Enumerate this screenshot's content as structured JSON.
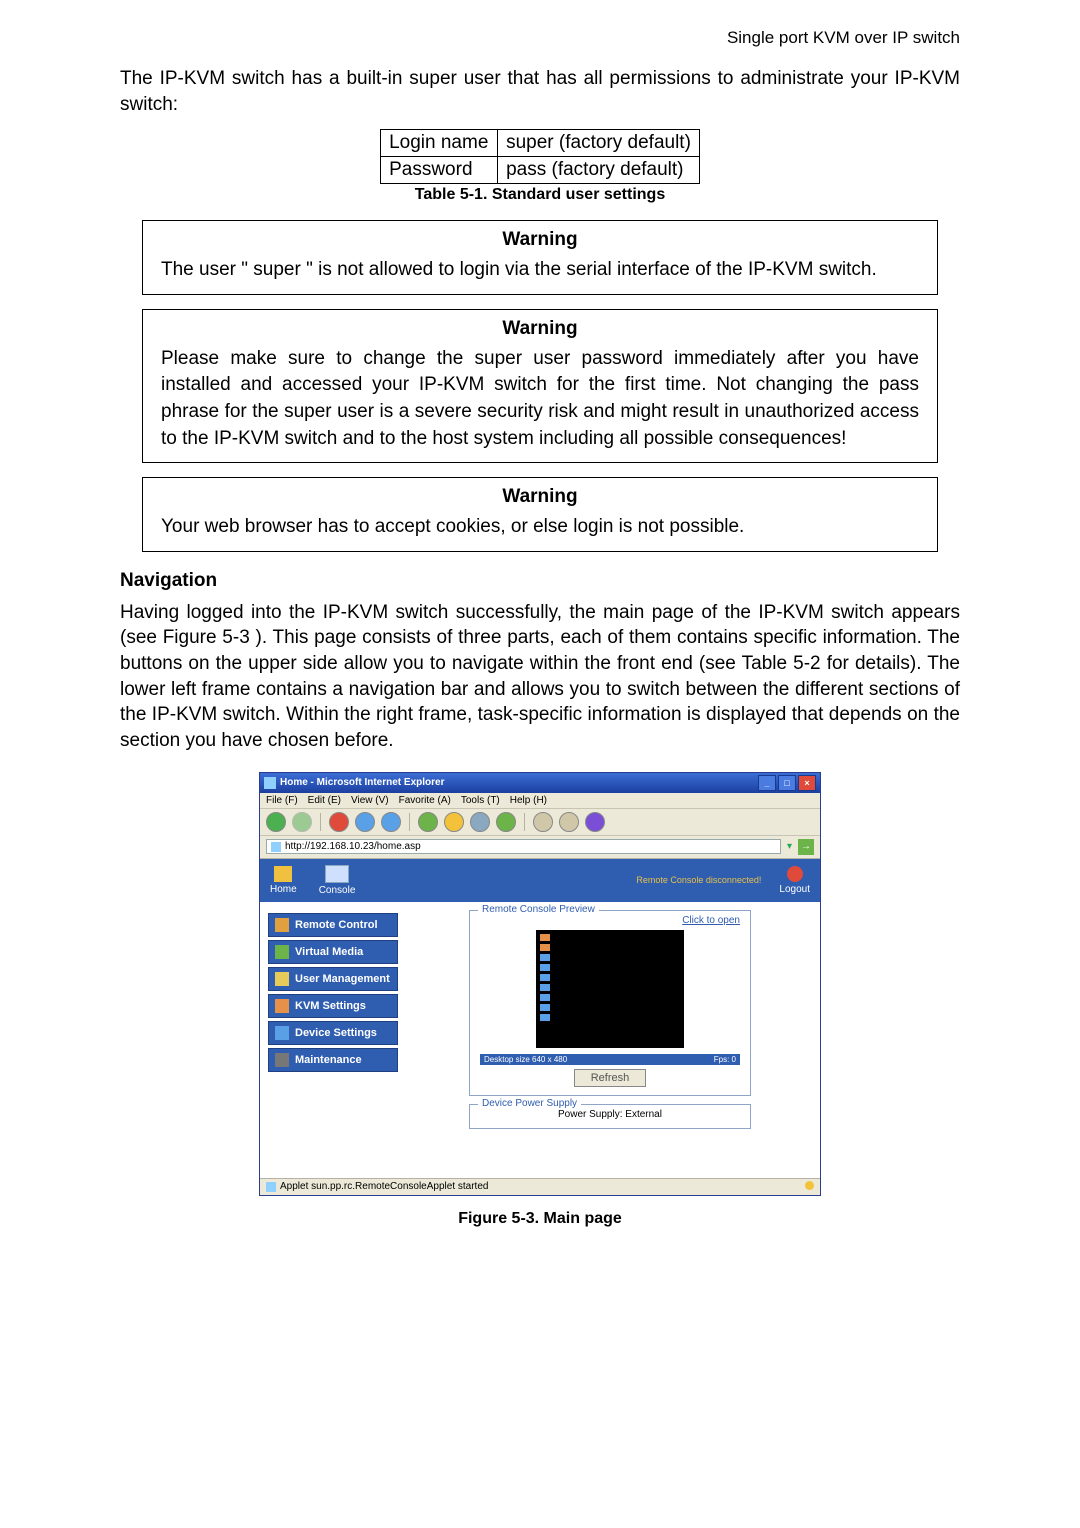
{
  "header": {
    "product": "Single port KVM over IP switch"
  },
  "intro": "The IP-KVM switch has a built-in super user that has all permissions to administrate your IP-KVM switch:",
  "cred_table": {
    "rows": [
      {
        "k": "Login name",
        "v": "super (factory default)"
      },
      {
        "k": "Password",
        "v": "pass (factory default)"
      }
    ],
    "caption": "Table 5-1. Standard user settings"
  },
  "warn1": {
    "title": "Warning",
    "body": "The user \" super \" is not allowed to login via the serial interface of the IP-KVM switch."
  },
  "warn2": {
    "title": "Warning",
    "body": "Please make sure to change the super user password immediately after you have installed and accessed your IP-KVM switch for the first time. Not changing the pass phrase for the super user is a severe security risk and might result in unauthorized access to the IP-KVM switch and to the host system including all possible consequences!"
  },
  "warn3": {
    "title": "Warning",
    "body": "Your web browser has to accept cookies, or else login is not possible."
  },
  "nav_heading": "Navigation",
  "nav_body": "Having logged into the IP-KVM switch successfully, the main page of the IP-KVM switch appears (see Figure 5-3 ). This page consists of three parts, each of them contains specific information. The buttons on the upper side allow you to navigate within the front end (see Table 5-2 for details). The lower left frame contains a navigation bar and allows you to switch between the different sections of the IP-KVM switch. Within the right frame, task-specific information is displayed that depends on the section you have chosen before.",
  "figure_caption": "Figure 5-3. Main page",
  "screenshot": {
    "window_title": "Home - Microsoft Internet Explorer",
    "menu": {
      "file": "File (F)",
      "edit": "Edit (E)",
      "view": "View (V)",
      "fav": "Favorite (A)",
      "tools": "Tools (T)",
      "help": "Help (H)"
    },
    "address_url": "http://192.168.10.23/home.asp",
    "go": "→",
    "topbar": {
      "home": "Home",
      "console": "Console",
      "status": "Remote Console disconnected!",
      "logout": "Logout"
    },
    "sidebar": [
      "Remote Control",
      "Virtual Media",
      "User Management",
      "KVM Settings",
      "Device Settings",
      "Maintenance"
    ],
    "preview": {
      "panel_title": "Remote Console Preview",
      "click": "Click to open",
      "caption_left": "Desktop size 640 x 480",
      "caption_right": "Fps: 0",
      "refresh": "Refresh"
    },
    "power": {
      "panel_title": "Device Power Supply",
      "text": "Power Supply: External"
    },
    "statusbar": "Applet sun.pp.rc.RemoteConsoleApplet started"
  }
}
